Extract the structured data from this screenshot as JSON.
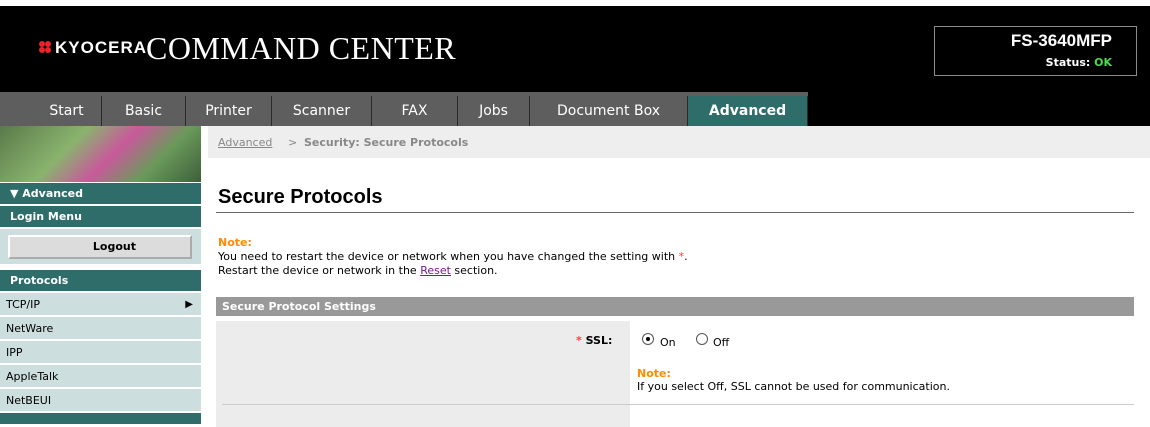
{
  "header": {
    "brand": "KYOCERA",
    "app_title": "COMMAND CENTER",
    "model": "FS-3640MFP",
    "status_label": "Status: ",
    "status_value": "OK"
  },
  "nav": {
    "tabs": [
      "Start",
      "Basic",
      "Printer",
      "Scanner",
      "FAX",
      "Jobs",
      "Document Box",
      "Advanced"
    ],
    "active": "Advanced"
  },
  "sidebar": {
    "section_advanced": "▼ Advanced",
    "login_menu": "Login Menu",
    "logout": "Logout",
    "protocols": "Protocols",
    "items": [
      "TCP/IP",
      "NetWare",
      "IPP",
      "AppleTalk",
      "NetBEUI"
    ]
  },
  "breadcrumb": {
    "parent": "Advanced",
    "separator": ">",
    "current": "Security: Secure Protocols"
  },
  "page": {
    "title": "Secure Protocols",
    "note_label": "Note:",
    "note_line1": "You need to restart the device or network when you have changed the setting with ",
    "note_star": "*",
    "note_line1_end": ".",
    "note_line2_pre": "Restart the device or network in the ",
    "note_line2_link": "Reset",
    "note_line2_post": " section."
  },
  "section": {
    "title": "Secure Protocol Settings",
    "ssl_star": "*",
    "ssl_label": "SSL:",
    "option_on": "On",
    "option_off": "Off",
    "selected": "On",
    "note_label": "Note:",
    "note_text": "If you select Off, SSL cannot be used for communication."
  },
  "colors": {
    "accent": "#2f6d6b",
    "note": "#ff8c00",
    "status_ok": "#4cdb4c"
  }
}
